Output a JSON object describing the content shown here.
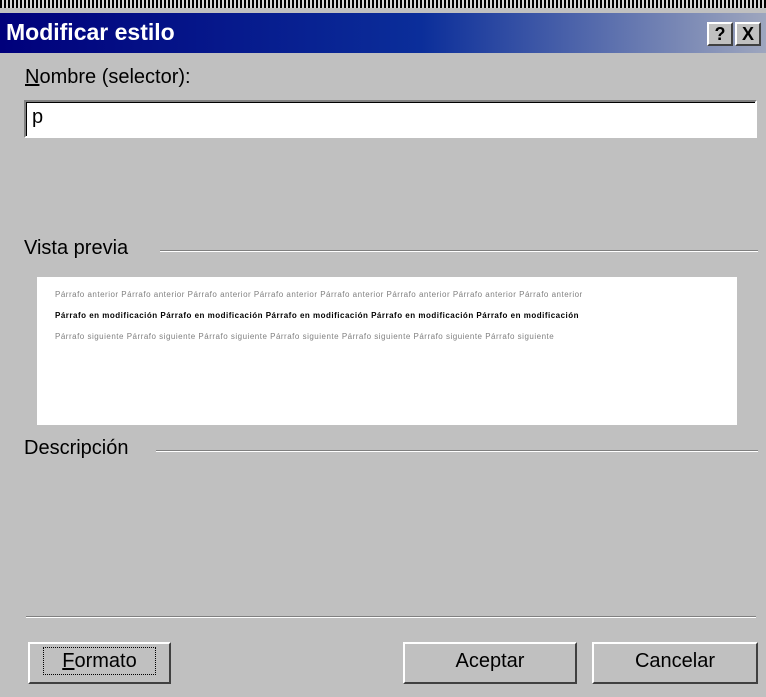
{
  "dialog": {
    "title": "Modificar estilo",
    "help_glyph": "?",
    "close_glyph": "X"
  },
  "name_field": {
    "label_accel": "N",
    "label_rest": "ombre (selector):",
    "value": "p"
  },
  "preview_section": {
    "label": "Vista previa",
    "previous_paragraph": "Párrafo anterior Párrafo anterior Párrafo anterior Párrafo anterior Párrafo anterior Párrafo anterior Párrafo anterior Párrafo anterior",
    "modified_paragraph": "Párrafo en modificación Párrafo en modificación Párrafo en modificación Párrafo en modificación Párrafo en modificación",
    "next_paragraph": "Párrafo siguiente Párrafo siguiente Párrafo siguiente Párrafo siguiente Párrafo siguiente Párrafo siguiente Párrafo siguiente"
  },
  "description_section": {
    "label": "Descripción"
  },
  "buttons": {
    "format_accel": "F",
    "format_rest": "ormato",
    "accept": "Aceptar",
    "cancel": "Cancelar"
  }
}
